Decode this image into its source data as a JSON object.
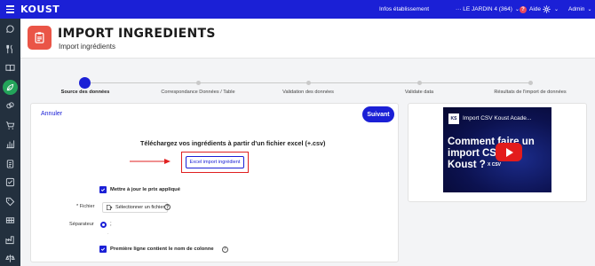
{
  "topbar": {
    "logo": "KOUST",
    "info_link": "Infos établissement",
    "site_selector": "··· LE JARDIN 4 (364)",
    "help_label": "Aide",
    "help_badge": "?",
    "user_menu": "Admin"
  },
  "sidebar": {
    "items": [
      "chat-bubble-icon",
      "utensils-icon",
      "book-icon",
      "ingredients-icon",
      "recipe-icon",
      "cart-icon",
      "chart-icon",
      "clipboard-icon",
      "checklist-icon",
      "tag-icon",
      "inventory-icon",
      "factory-icon",
      "scale-icon"
    ],
    "active_index": 3
  },
  "header": {
    "title": "IMPORT INGREDIENTS",
    "subtitle": "Import ingrédients"
  },
  "stepper": {
    "steps": [
      {
        "label": "Source des données",
        "active": true
      },
      {
        "label": "Correspondance Données / Table",
        "active": false
      },
      {
        "label": "Validation des données",
        "active": false
      },
      {
        "label": "Validate data",
        "active": false
      },
      {
        "label": "Résultats de l'import de données",
        "active": false
      }
    ]
  },
  "form": {
    "cancel_label": "Annuler",
    "next_label": "Suivant",
    "download_text": "Téléchargez vos ingrédients à partir d'un fichier excel (+.csv)",
    "excel_button": "Excel import ingrédient",
    "update_price_label": "Mettre à jour le prix appliqué",
    "update_price_checked": true,
    "file_label": "* Fichier",
    "file_button": "Sélectionner un fichier",
    "separator_label": "Séparateur",
    "separator_value": ";",
    "separator_dot": ".",
    "header_row_label": "Première ligne contient le nom de colonne",
    "header_row_checked": true
  },
  "video": {
    "logo_text": "KS",
    "title": "Import CSV Koust Acade...",
    "big_text": "Comment faire un import CSV sur Koust ?",
    "file_icon_text": "X CSV"
  },
  "colors": {
    "primary": "#1b20d6",
    "sidebar_bg": "#23303e",
    "sidebar_active": "#23a45a",
    "header_icon": "#ea5547",
    "highlight_red": "#e02020"
  }
}
